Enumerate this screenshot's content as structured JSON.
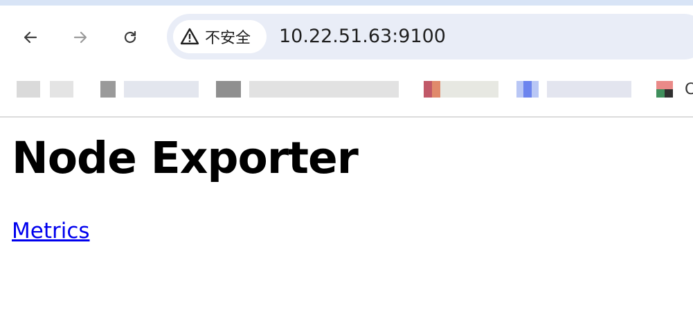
{
  "browser": {
    "url": "10.22.51.63:9100",
    "security_label": "不安全",
    "bookmark_bar_visible_fragment": "C"
  },
  "page": {
    "title": "Node Exporter",
    "link_label": "Metrics"
  },
  "colors": {
    "omnibox_bg": "#e9edf7",
    "link": "#0000ee",
    "top_strip": "#d8e4f6"
  }
}
